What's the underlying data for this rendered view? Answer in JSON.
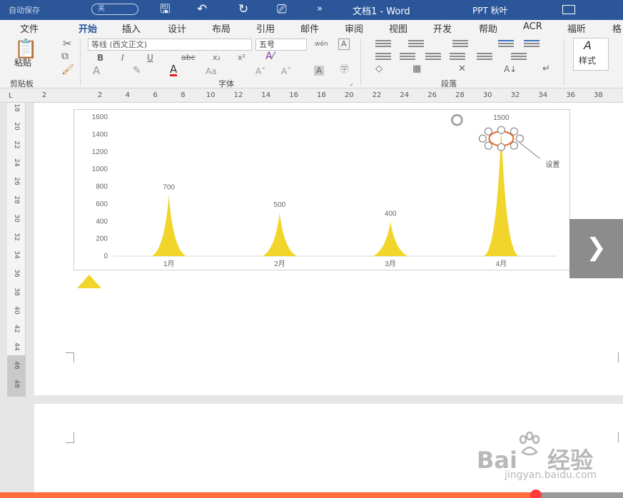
{
  "titlebar": {
    "autosave": "自动保存",
    "autosave_state": "关",
    "doc_title": "文档1 - Word",
    "user": "PPT 秋叶"
  },
  "tabs": [
    "文件",
    "开始",
    "插入",
    "设计",
    "布局",
    "引用",
    "邮件",
    "审阅",
    "视图",
    "开发",
    "帮助",
    "ACR",
    "福昕",
    "格"
  ],
  "active_tab": "开始",
  "ribbon": {
    "paste_label": "粘贴",
    "font_name": "等线 (西文正文)",
    "font_size": "五号",
    "styles_label": "样式",
    "group_clipboard": "剪贴板",
    "group_font": "字体",
    "group_paragraph": "段落"
  },
  "ruler": {
    "corner": "L",
    "ticks": [
      "2",
      "2",
      "4",
      "6",
      "8",
      "10",
      "12",
      "14",
      "16",
      "18",
      "20",
      "22",
      "24",
      "26",
      "28",
      "30",
      "32",
      "34",
      "36",
      "38"
    ],
    "vticks": [
      "18",
      "20",
      "22",
      "24",
      "26",
      "28",
      "30",
      "32",
      "34",
      "36",
      "38",
      "40",
      "42",
      "44",
      "46",
      "48"
    ]
  },
  "chart_data": {
    "type": "area",
    "categories": [
      "1月",
      "2月",
      "3月",
      "4月"
    ],
    "values": [
      700,
      500,
      400,
      1500
    ],
    "data_labels": [
      "700",
      "500",
      "400",
      "1500"
    ],
    "yticks": [
      "0",
      "200",
      "400",
      "600",
      "800",
      "1000",
      "1200",
      "1400",
      "1600"
    ],
    "ylim": [
      0,
      1600
    ],
    "fill_color": "#f2d52a",
    "grid": false,
    "annotation": "设置"
  },
  "watermark": {
    "logo": "Bai",
    "logo2": "经验",
    "url": "jingyan.baidu.com"
  },
  "colors": {
    "brand": "#2b579a",
    "progress": "#ff6b3d"
  }
}
